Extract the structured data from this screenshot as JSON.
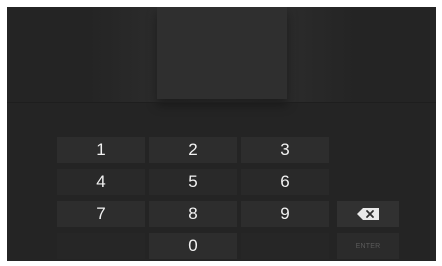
{
  "keypad": {
    "keys": [
      "1",
      "2",
      "3",
      "4",
      "5",
      "6",
      "7",
      "8",
      "9",
      "0"
    ],
    "backspace_icon": "backspace-icon",
    "ok_label": "ENTER"
  },
  "colors": {
    "background": "#242424",
    "key": "#2d2d2d",
    "text": "#f2f2f2"
  }
}
